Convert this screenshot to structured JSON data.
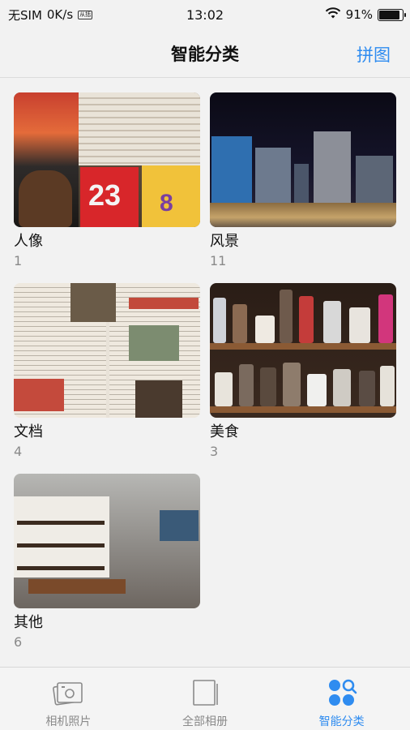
{
  "status_bar": {
    "carrier": "无SIM",
    "speed": "0K/s",
    "speed_chip": "从括",
    "time": "13:02",
    "battery_text": "91%",
    "battery_level": 0.91
  },
  "header": {
    "title": "智能分类",
    "action": "拼图"
  },
  "albums": [
    {
      "name": "人像",
      "count": "1"
    },
    {
      "name": "风景",
      "count": "11"
    },
    {
      "name": "文档",
      "count": "4"
    },
    {
      "name": "美食",
      "count": "3"
    },
    {
      "name": "其他",
      "count": "6"
    }
  ],
  "thumb_text": {
    "jersey_number": "23",
    "jersey_back": "8"
  },
  "tabbar": {
    "tabs": [
      {
        "label": "相机照片",
        "icon": "camera-photos-icon"
      },
      {
        "label": "全部相册",
        "icon": "all-albums-icon"
      },
      {
        "label": "智能分类",
        "icon": "smart-category-icon",
        "active": true
      }
    ]
  },
  "colors": {
    "accent": "#2f8cf0",
    "background": "#f2f2f2",
    "muted_text": "#8a8a8a"
  }
}
